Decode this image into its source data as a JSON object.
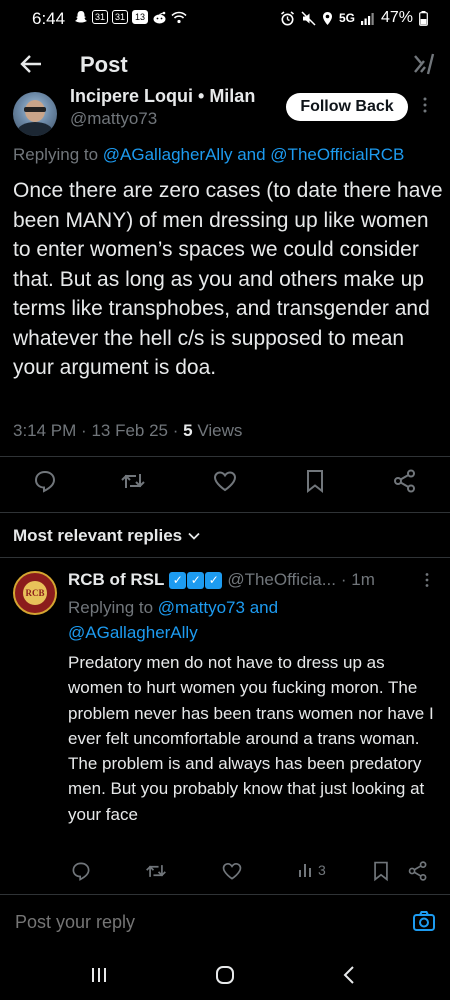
{
  "status_bar": {
    "time": "6:44",
    "calendar_1": "31",
    "calendar_2": "31",
    "badge": "13",
    "network": "5G",
    "battery": "47%"
  },
  "header": {
    "title": "Post"
  },
  "post": {
    "author_name": "Incipere Loqui • Milan",
    "author_handle": "@mattyo73",
    "follow_label": "Follow Back",
    "replying_prefix": "Replying to ",
    "replying_to_1": "@AGallagherAlly",
    "replying_and": " and ",
    "replying_to_2": "@TheOfficialRCB",
    "text": "Once there are zero cases (to date there have been MANY) of men dressing up like women to enter women’s spaces we could consider that. But as long as you and others make up terms like transphobes, and transgender and whatever the hell c/s is supposed to mean your argument is doa.",
    "time": "3:14 PM",
    "date": "13 Feb 25",
    "views_count": "5",
    "views_label": " Views"
  },
  "replies_section": {
    "label": "Most relevant replies"
  },
  "reply": {
    "name": "RCB of RSL",
    "badges": "✓✓✓",
    "handle": "@TheOfficia...",
    "time": "· 1m",
    "replying_prefix": "Replying to ",
    "replying_to_1": "@mattyo73",
    "replying_and": " and",
    "replying_to_2": "@AGallagherAlly",
    "text": "Predatory men do not have to dress up as women to hurt women  you fucking moron.  The problem never has been trans women nor have I ever felt uncomfortable around a trans woman. The problem is and always has been predatory men. But you probably know that just looking at your face",
    "views": "3",
    "avatar_text": "RCB"
  },
  "composer": {
    "placeholder": "Post your reply"
  },
  "colors": {
    "accent": "#1d9bf0",
    "background": "#000000",
    "muted": "#71767b",
    "text": "#e7e9ea"
  }
}
